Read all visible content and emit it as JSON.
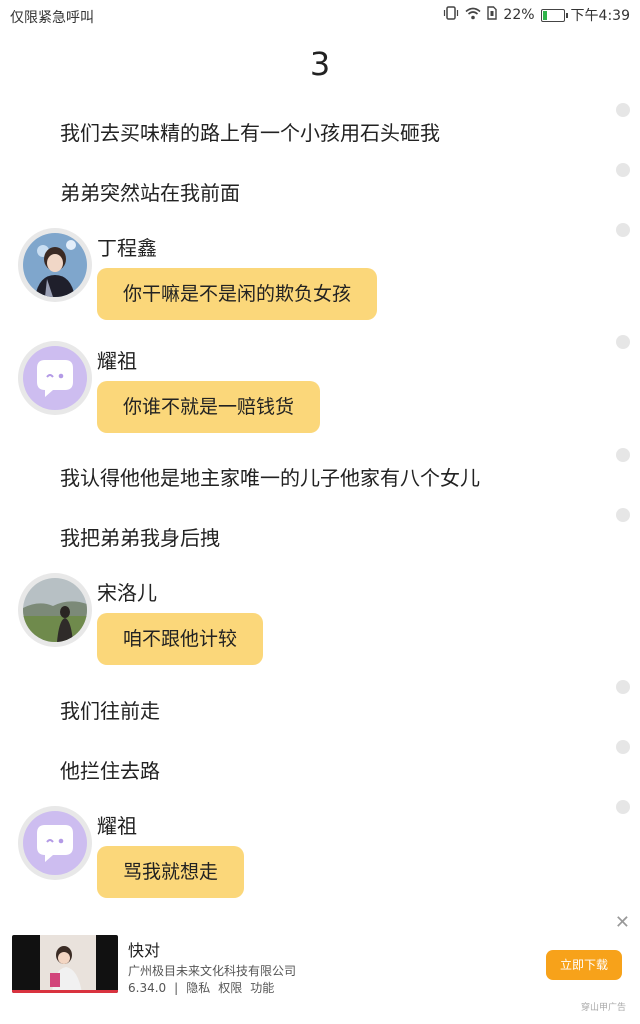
{
  "status_bar": {
    "left_text": "仅限紧急呼叫",
    "battery_percent": 22,
    "battery_text": "22%",
    "time": "下午4:39",
    "icons": [
      "vibrate-icon",
      "wifi-icon",
      "sim-icon",
      "battery-icon"
    ]
  },
  "chapter": {
    "title": "3"
  },
  "messages": [
    {
      "type": "narration",
      "text": "我们去买味精的路上有一个小孩用石头砸我"
    },
    {
      "type": "narration",
      "text": "弟弟突然站在我前面"
    },
    {
      "type": "dialog",
      "speaker": "丁程鑫",
      "avatar": "person-photo",
      "text": "你干嘛是不是闲的欺负女孩"
    },
    {
      "type": "dialog",
      "speaker": "耀祖",
      "avatar": "purple-chat-icon",
      "text": "你谁不就是一赔钱货"
    },
    {
      "type": "narration",
      "text": "我认得他他是地主家唯一的儿子他家有八个女儿"
    },
    {
      "type": "narration",
      "text": "我把弟弟我身后拽"
    },
    {
      "type": "dialog",
      "speaker": "宋洛儿",
      "avatar": "landscape-photo",
      "text": "咱不跟他计较"
    },
    {
      "type": "narration",
      "text": "我们往前走"
    },
    {
      "type": "narration",
      "text": "他拦住去路"
    },
    {
      "type": "dialog",
      "speaker": "耀祖",
      "avatar": "purple-chat-icon",
      "text": "骂我就想走"
    }
  ],
  "ad": {
    "title": "快对",
    "company": "广州极目未来文化科技有限公司",
    "version": "6.34.0",
    "links": [
      "隐私",
      "权限",
      "功能"
    ],
    "button_label": "立即下载",
    "source_label": "穿山甲广告",
    "close_icon": "close-icon",
    "colors": {
      "button": "#f7a21a"
    }
  },
  "colors": {
    "bubble": "#fbd77a",
    "avatar_purple": "#c9b8ec"
  }
}
